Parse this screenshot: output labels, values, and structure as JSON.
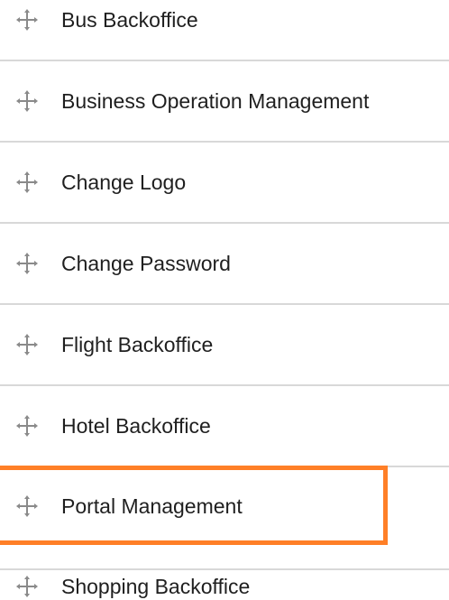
{
  "menu": {
    "items": [
      {
        "label": "Bus Backoffice",
        "icon": "move-icon",
        "selected": false
      },
      {
        "label": "Business Operation Management",
        "icon": "move-icon",
        "selected": false
      },
      {
        "label": "Change Logo",
        "icon": "move-icon",
        "selected": false
      },
      {
        "label": "Change Password",
        "icon": "move-icon",
        "selected": false
      },
      {
        "label": "Flight Backoffice",
        "icon": "move-icon",
        "selected": false
      },
      {
        "label": "Hotel Backoffice",
        "icon": "move-icon",
        "selected": false
      },
      {
        "label": "Portal Management",
        "icon": "move-icon",
        "selected": true
      },
      {
        "label": "Shopping Backoffice",
        "icon": "move-icon",
        "selected": false
      }
    ]
  },
  "colors": {
    "highlight": "#ff7f27",
    "divider": "#d8d8d8",
    "text": "#1f1f1f",
    "icon": "#8a8a8a"
  }
}
